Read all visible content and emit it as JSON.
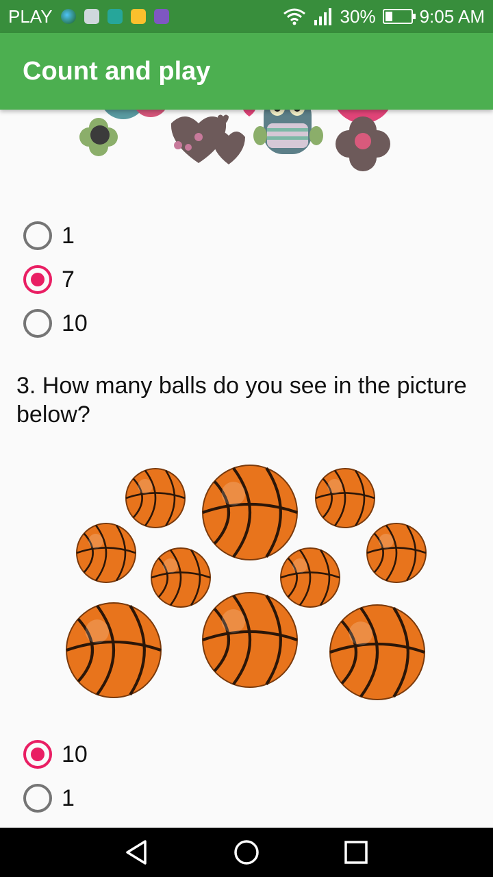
{
  "status_bar": {
    "carrier": "PLAY",
    "battery_percent": "30%",
    "battery_level": 0.3,
    "time": "9:05 AM",
    "notification_icons": [
      "globe-icon",
      "mail-icon",
      "android-icon",
      "lock-icon",
      "gallery-icon"
    ]
  },
  "app_bar": {
    "title": "Count and play"
  },
  "question2": {
    "options": [
      {
        "label": "1",
        "checked": false
      },
      {
        "label": "7",
        "checked": true
      },
      {
        "label": "10",
        "checked": false
      }
    ]
  },
  "question3": {
    "text": "3. How many balls do you see in the picture below?",
    "options": [
      {
        "label": "10",
        "checked": true
      },
      {
        "label": "1",
        "checked": false
      }
    ]
  },
  "colors": {
    "status_bar": "#388e3c",
    "app_bar": "#4caf50",
    "radio_checked": "#e91e63",
    "radio_unchecked": "#757575",
    "ball": "#e8741c"
  },
  "nav_bar": {
    "icons": [
      "back-icon",
      "home-icon",
      "recents-icon"
    ]
  }
}
